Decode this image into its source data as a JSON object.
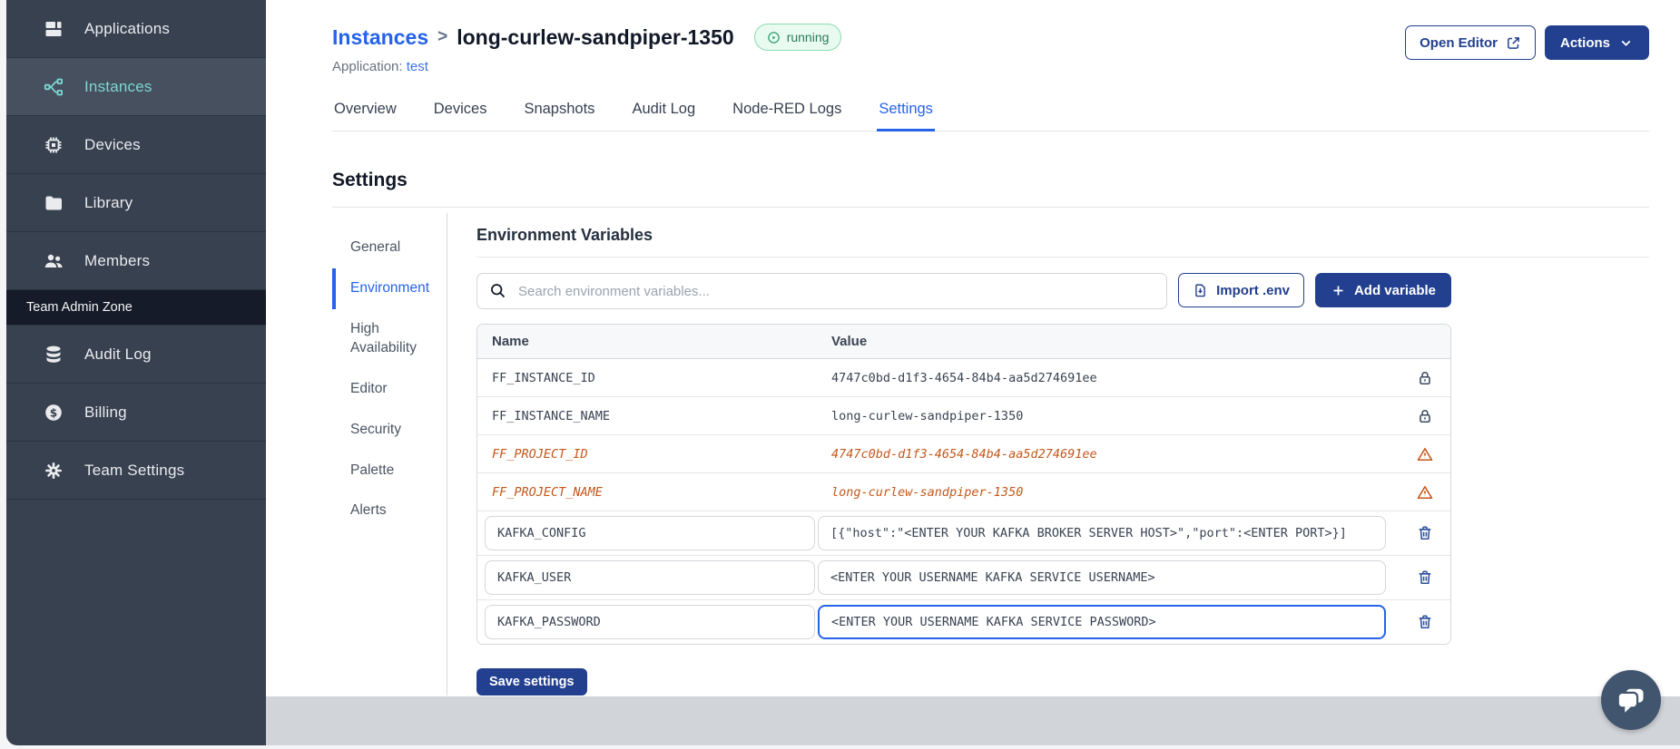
{
  "sidebar": {
    "items": [
      {
        "label": "Applications",
        "icon": "applications",
        "active": false
      },
      {
        "label": "Instances",
        "icon": "instances",
        "active": true
      },
      {
        "label": "Devices",
        "icon": "devices",
        "active": false
      },
      {
        "label": "Library",
        "icon": "library",
        "active": false
      },
      {
        "label": "Members",
        "icon": "members",
        "active": false
      }
    ],
    "section_label": "Team Admin Zone",
    "admin_items": [
      {
        "label": "Audit Log",
        "icon": "audit-log",
        "active": false
      },
      {
        "label": "Billing",
        "icon": "billing",
        "active": false
      },
      {
        "label": "Team Settings",
        "icon": "team-settings",
        "active": false
      }
    ]
  },
  "header": {
    "breadcrumb": {
      "parent": "Instances",
      "separator": ">",
      "current": "long-curlew-sandpiper-1350"
    },
    "status_badge": "running",
    "application_label": "Application:",
    "application_name": "test",
    "open_editor_label": "Open Editor",
    "actions_label": "Actions"
  },
  "tabs": [
    {
      "label": "Overview",
      "active": false
    },
    {
      "label": "Devices",
      "active": false
    },
    {
      "label": "Snapshots",
      "active": false
    },
    {
      "label": "Audit Log",
      "active": false
    },
    {
      "label": "Node-RED Logs",
      "active": false
    },
    {
      "label": "Settings",
      "active": true
    }
  ],
  "settings": {
    "title": "Settings",
    "nav": [
      {
        "label": "General",
        "active": false
      },
      {
        "label": "Environment",
        "active": true
      },
      {
        "label": "High Availability",
        "active": false
      },
      {
        "label": "Editor",
        "active": false
      },
      {
        "label": "Security",
        "active": false
      },
      {
        "label": "Palette",
        "active": false
      },
      {
        "label": "Alerts",
        "active": false
      }
    ],
    "panel": {
      "title": "Environment Variables",
      "search_placeholder": "Search environment variables...",
      "import_button": "Import .env",
      "add_button": "Add variable",
      "table": {
        "columns": [
          "Name",
          "Value"
        ],
        "rows": [
          {
            "name": "FF_INSTANCE_ID",
            "value": "4747c0bd-d1f3-4654-84b4-aa5d274691ee",
            "type": "locked"
          },
          {
            "name": "FF_INSTANCE_NAME",
            "value": "long-curlew-sandpiper-1350",
            "type": "locked"
          },
          {
            "name": "FF_PROJECT_ID",
            "value": "4747c0bd-d1f3-4654-84b4-aa5d274691ee",
            "type": "deprecated"
          },
          {
            "name": "FF_PROJECT_NAME",
            "value": "long-curlew-sandpiper-1350",
            "type": "deprecated"
          },
          {
            "name": "KAFKA_CONFIG",
            "value": "[{\"host\":\"<ENTER YOUR KAFKA BROKER SERVER HOST>\",\"port\":<ENTER PORT>}]",
            "type": "editable",
            "focused": false
          },
          {
            "name": "KAFKA_USER",
            "value": "<ENTER YOUR USERNAME KAFKA SERVICE USERNAME>",
            "type": "editable",
            "focused": false
          },
          {
            "name": "KAFKA_PASSWORD",
            "value": "<ENTER YOUR USERNAME KAFKA SERVICE PASSWORD>",
            "type": "editable",
            "focused": true
          }
        ]
      },
      "save_button": "Save settings"
    }
  },
  "colors": {
    "accent_blue": "#2563EB",
    "navy": "#22408F",
    "sidebar_teal": "#7CD7D2",
    "warning_orange": "#C4581C",
    "status_green": "#2F7A5D"
  }
}
